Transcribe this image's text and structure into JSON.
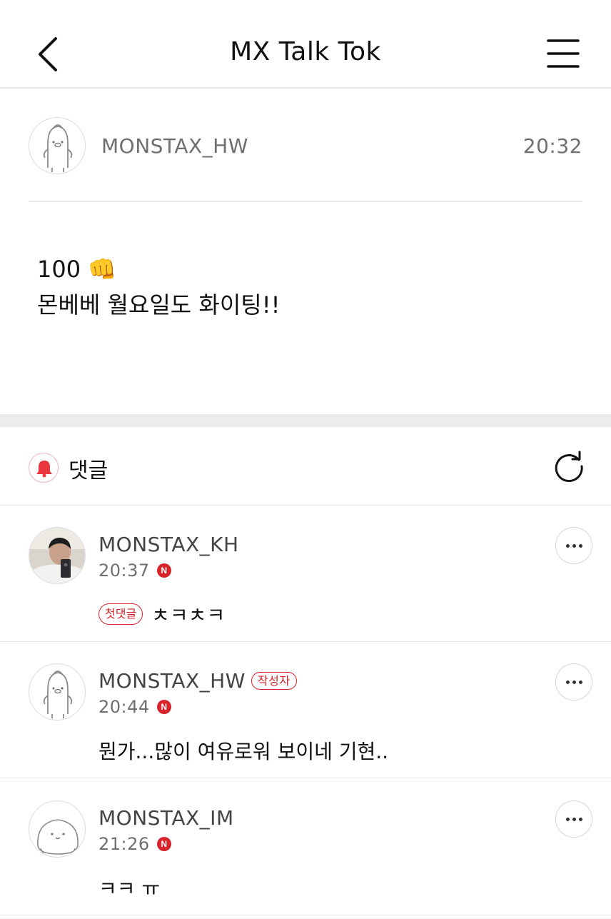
{
  "header": {
    "title": "MX Talk Tok",
    "back_icon": "chevron-left-icon",
    "menu_icon": "hamburger-menu-icon"
  },
  "post": {
    "author": "MONSTAX_HW",
    "time": "20:32",
    "body_line1": "100 👊",
    "body_line2": "몬베베 월요일도 화이팅!!"
  },
  "comments_section": {
    "label": "댓글",
    "bell_icon": "bell-icon",
    "refresh_icon": "refresh-icon",
    "accent_color": "#d8232a"
  },
  "comments": [
    {
      "name": "MONSTAX_KH",
      "time": "20:37",
      "new_badge": "N",
      "tag": "첫댓글",
      "text": "ㅊㅋㅊㅋ"
    },
    {
      "name": "MONSTAX_HW",
      "author_tag": "작성자",
      "time": "20:44",
      "new_badge": "N",
      "text": "뭔가...많이 여유로워 보이네 기현.."
    },
    {
      "name": "MONSTAX_IM",
      "time": "21:26",
      "new_badge": "N",
      "text": "ㅋㅋ ㅠ"
    }
  ]
}
